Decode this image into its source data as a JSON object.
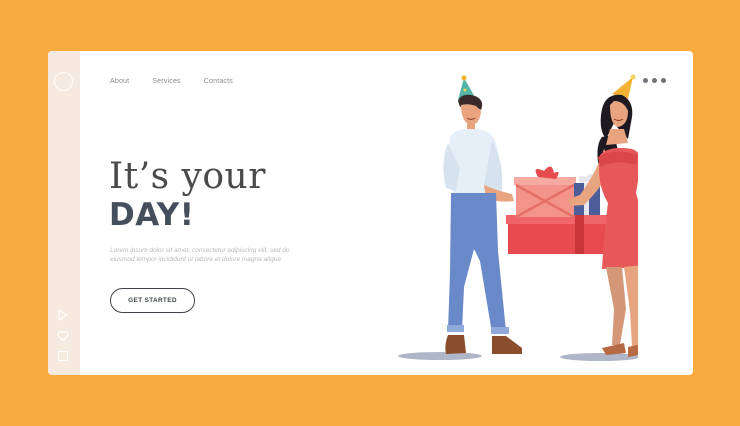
{
  "nav": {
    "items": [
      "About",
      "Services",
      "Contacts"
    ]
  },
  "hero": {
    "line1": "It’s your",
    "line2": "DAY!",
    "body": "Lorem ipsum dolor sit amet, consectetur adipiscing elit, sed do eiusmod tempor incididunt ut labore et dolore magna aliqua",
    "cta_label": "GET STARTED"
  },
  "sidebar": {
    "icons": [
      "play-icon",
      "heart-icon",
      "square-icon"
    ]
  },
  "menu": {
    "icon": "more-dots-icon"
  },
  "illustration": {
    "subject": "man-giving-gifts-to-woman-illustration"
  },
  "colors": {
    "background": "#F9AC3D",
    "card": "#FFFFFF",
    "sidebar": "#F6E9DF",
    "heading": "#454F5C",
    "gift_red": "#E84B4F",
    "gift_pink": "#F4938A",
    "dress": "#E7585B",
    "jeans": "#6A89C9"
  }
}
